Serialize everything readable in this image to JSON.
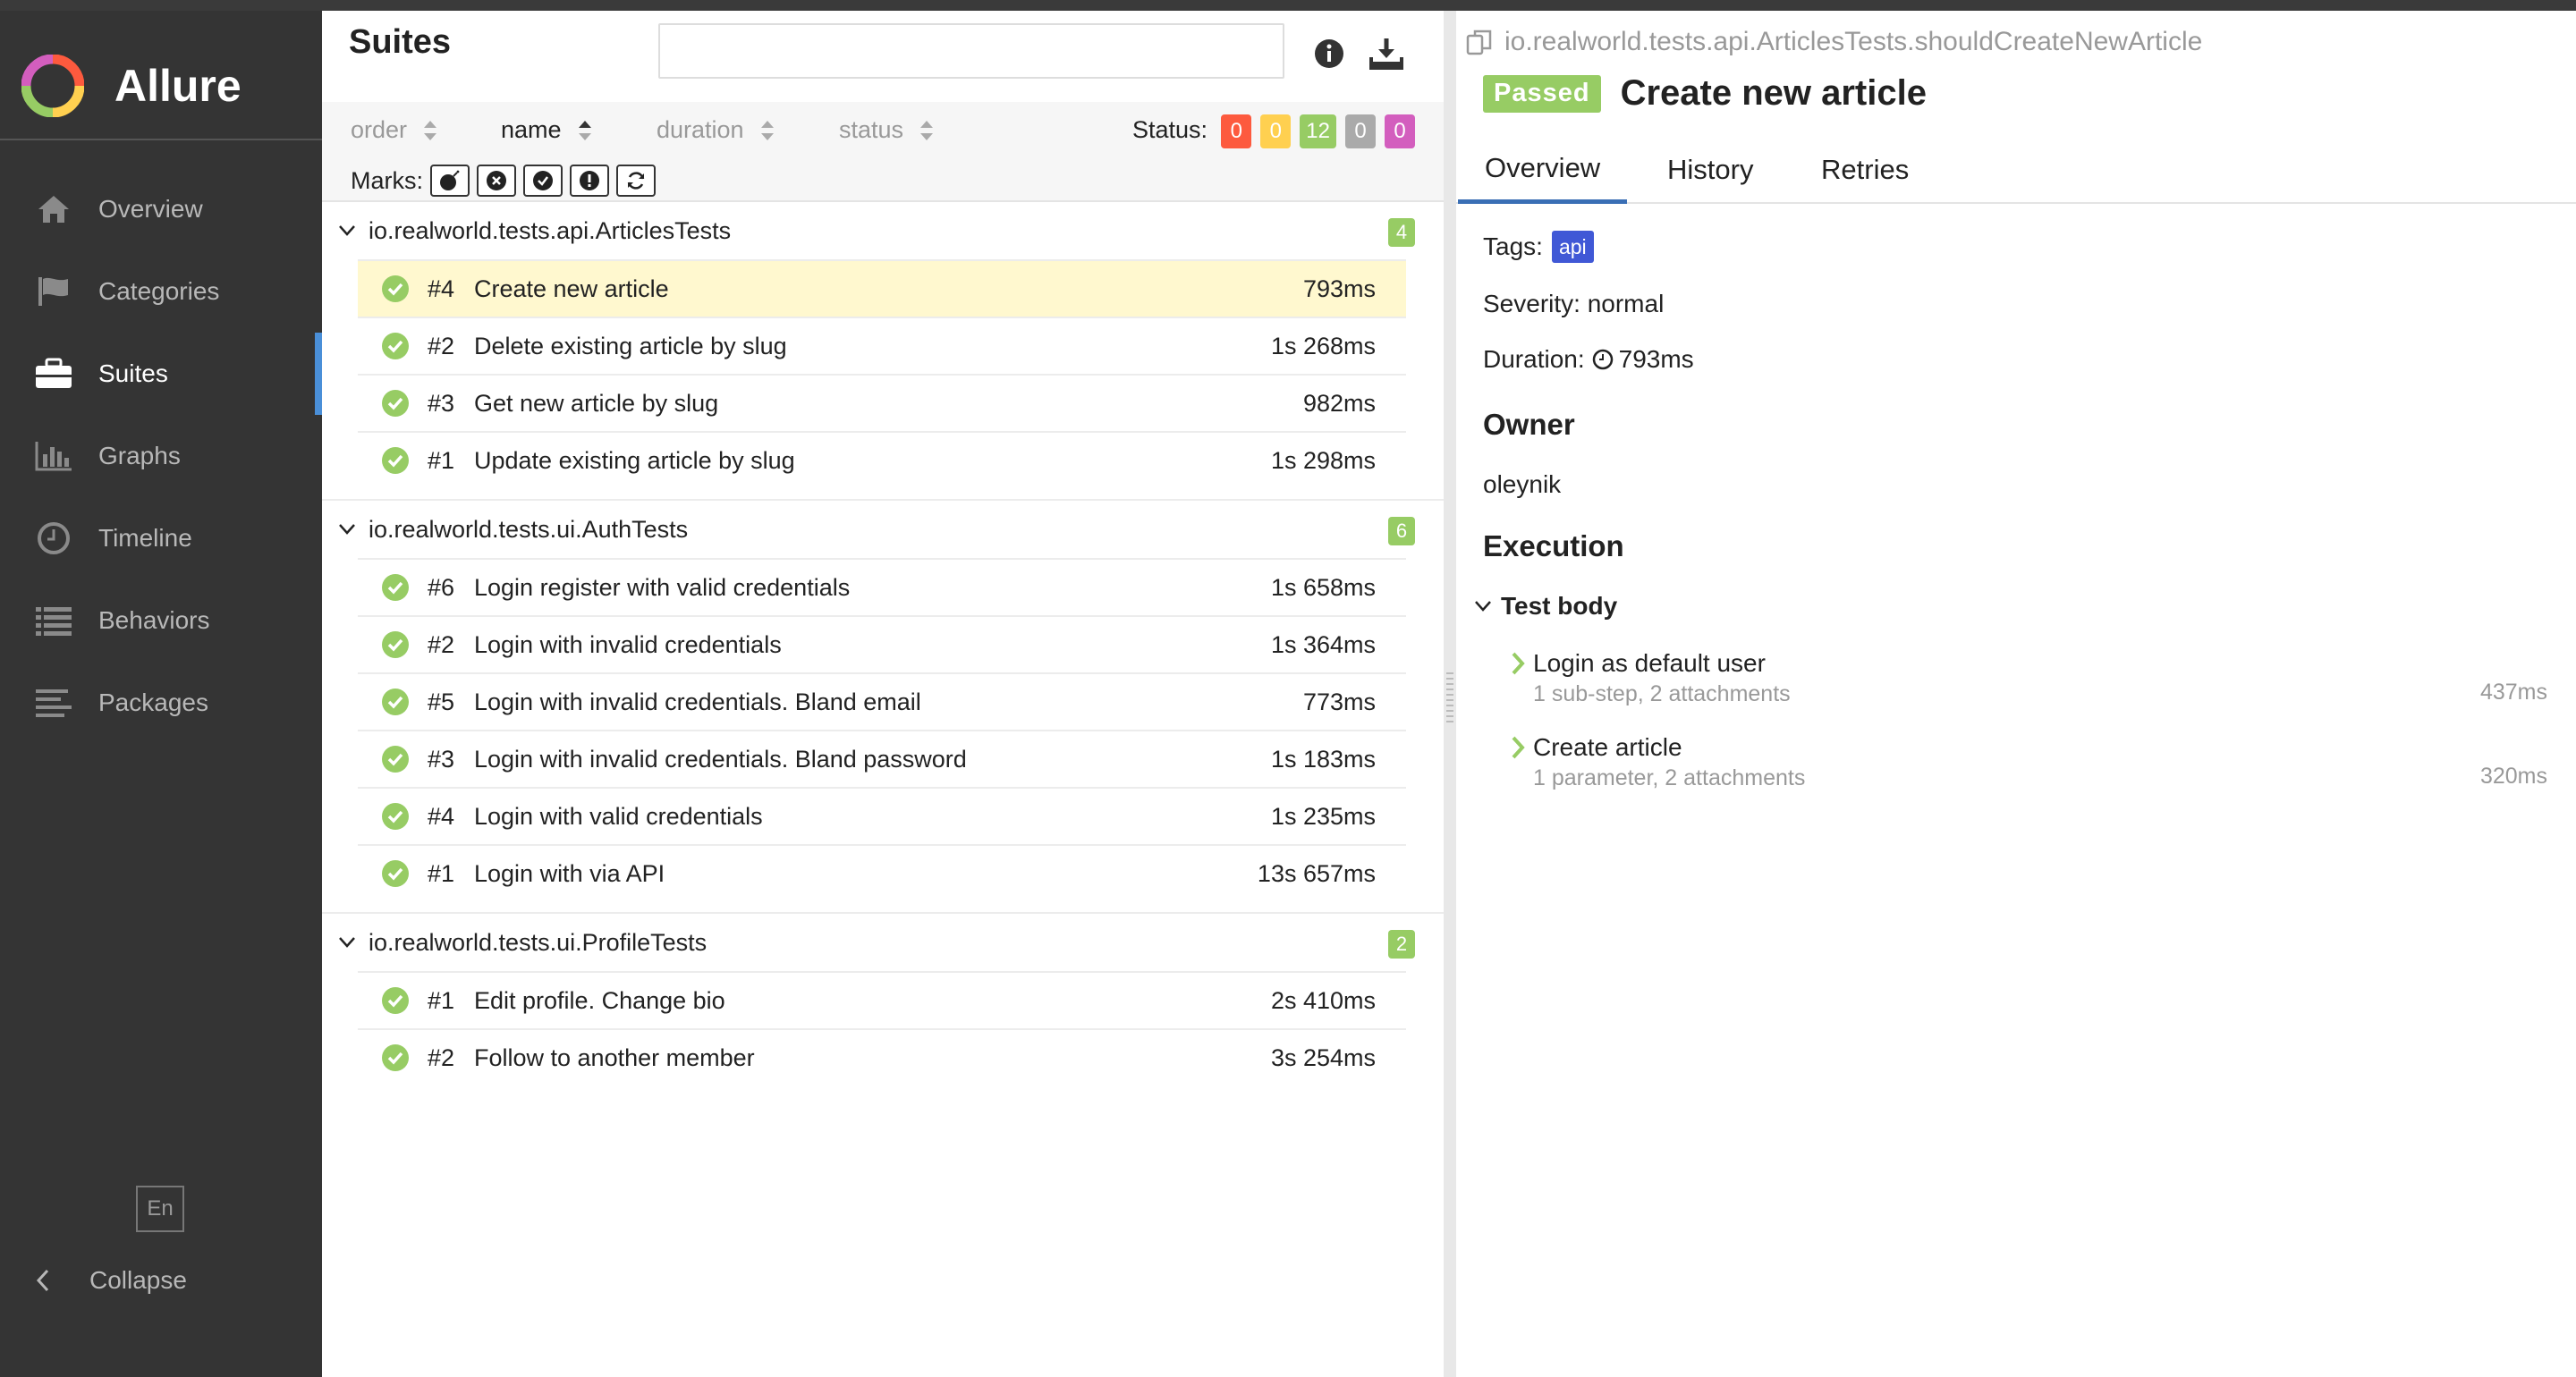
{
  "app": {
    "name": "Allure"
  },
  "sidebar": {
    "items": [
      {
        "label": "Overview",
        "icon": "home-icon"
      },
      {
        "label": "Categories",
        "icon": "flag-icon"
      },
      {
        "label": "Suites",
        "icon": "briefcase-icon",
        "active": true
      },
      {
        "label": "Graphs",
        "icon": "bar-chart-icon"
      },
      {
        "label": "Timeline",
        "icon": "clock-icon"
      },
      {
        "label": "Behaviors",
        "icon": "list-icon"
      },
      {
        "label": "Packages",
        "icon": "align-left-icon"
      }
    ],
    "language": "En",
    "collapse_label": "Collapse"
  },
  "suites": {
    "title": "Suites",
    "search_value": "",
    "sort": {
      "order": "order",
      "name": "name",
      "duration": "duration",
      "status": "status"
    },
    "status_label": "Status:",
    "status_counts": [
      {
        "value": "0",
        "color": "#fd5a3e"
      },
      {
        "value": "0",
        "color": "#ffd050"
      },
      {
        "value": "12",
        "color": "#97cc64"
      },
      {
        "value": "0",
        "color": "#aaaaaa"
      },
      {
        "value": "0",
        "color": "#d35ebe"
      }
    ],
    "marks_label": "Marks:",
    "groups": [
      {
        "name": "io.realworld.tests.api.ArticlesTests",
        "count": "4",
        "tests": [
          {
            "num": "#4",
            "name": "Create new article",
            "duration": "793ms",
            "selected": true
          },
          {
            "num": "#2",
            "name": "Delete existing article by slug",
            "duration": "1s 268ms"
          },
          {
            "num": "#3",
            "name": "Get new article by slug",
            "duration": "982ms"
          },
          {
            "num": "#1",
            "name": "Update existing article by slug",
            "duration": "1s 298ms"
          }
        ]
      },
      {
        "name": "io.realworld.tests.ui.AuthTests",
        "count": "6",
        "tests": [
          {
            "num": "#6",
            "name": "Login register with valid credentials",
            "duration": "1s 658ms"
          },
          {
            "num": "#2",
            "name": "Login with invalid credentials",
            "duration": "1s 364ms"
          },
          {
            "num": "#5",
            "name": "Login with invalid credentials. Bland email",
            "duration": "773ms"
          },
          {
            "num": "#3",
            "name": "Login with invalid credentials. Bland password",
            "duration": "1s 183ms"
          },
          {
            "num": "#4",
            "name": "Login with valid credentials",
            "duration": "1s 235ms"
          },
          {
            "num": "#1",
            "name": "Login with via API",
            "duration": "13s 657ms"
          }
        ]
      },
      {
        "name": "io.realworld.tests.ui.ProfileTests",
        "count": "2",
        "tests": [
          {
            "num": "#1",
            "name": "Edit profile. Change bio",
            "duration": "2s 410ms"
          },
          {
            "num": "#2",
            "name": "Follow to another member",
            "duration": "3s 254ms"
          }
        ]
      }
    ]
  },
  "testcase": {
    "full_name": "io.realworld.tests.api.ArticlesTests.shouldCreateNewArticle",
    "status": "Passed",
    "title": "Create new article",
    "tabs": [
      "Overview",
      "History",
      "Retries"
    ],
    "tags_label": "Tags:",
    "tag": "api",
    "severity": "Severity: normal",
    "duration_label": "Duration:",
    "duration": "793ms",
    "owner_heading": "Owner",
    "owner": "oleynik",
    "execution_heading": "Execution",
    "test_body_label": "Test body",
    "steps": [
      {
        "name": "Login as default user",
        "meta": "1 sub-step, 2 attachments",
        "duration": "437ms"
      },
      {
        "name": "Create article",
        "meta": "1 parameter, 2 attachments",
        "duration": "320ms"
      }
    ]
  }
}
